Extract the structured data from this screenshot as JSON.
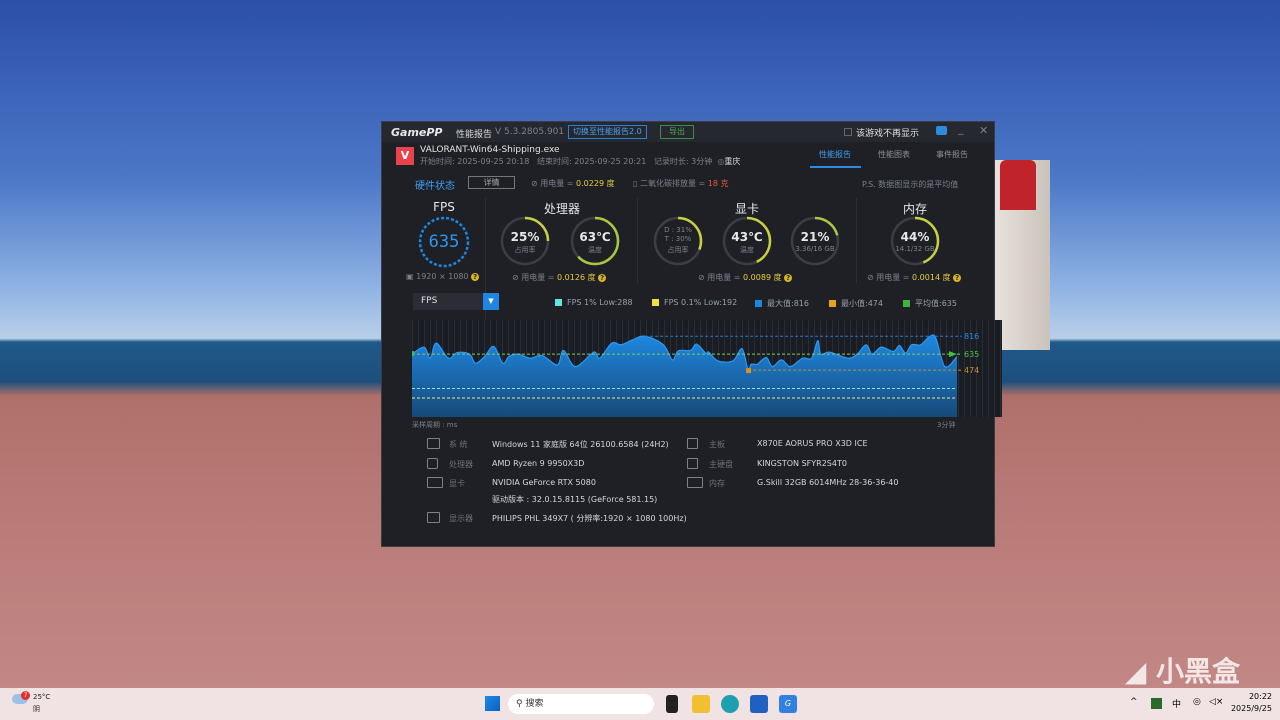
{
  "app": {
    "logo": "GamePP",
    "title": "性能报告",
    "version": "V 5.3.2805.901",
    "switch_btn": "切换至性能报告2.0",
    "export_btn": "导出",
    "no_show": "该游戏不再显示"
  },
  "session": {
    "exe": "VALORANT-Win64-Shipping.exe",
    "start": "开始时间: 2025-09-25 20:18",
    "end": "结束时间: 2025-09-25 20:21",
    "duration": "记录时长: 3分钟",
    "location": "重庆"
  },
  "tabs": [
    {
      "label": "性能报告",
      "active": true
    },
    {
      "label": "性能图表"
    },
    {
      "label": "事件报告"
    }
  ],
  "hardware": {
    "label": "硬件状态",
    "detail_btn": "详情",
    "power_label": "用电量 =",
    "power": "0.0229 度",
    "co2_label": "二氧化碳排放量 =",
    "co2": "18 克",
    "note": "P.S. 数据图显示的是平均值"
  },
  "fps_panel": {
    "title": "FPS",
    "value": "635",
    "resolution": "1920 × 1080"
  },
  "cpu_panel": {
    "title": "处理器",
    "usage": "25%",
    "usage_label": "占用率",
    "usage_frac": 0.25,
    "temp": "63℃",
    "temp_label": "温度",
    "temp_frac": 0.63,
    "power_label": "用电量 =",
    "power": "0.0126 度"
  },
  "gpu_panel": {
    "title": "显卡",
    "d": "D : 31%",
    "t": "T : 30%",
    "usage_label": "占用率",
    "usage_frac": 0.31,
    "temp": "43℃",
    "temp_label": "温度",
    "temp_frac": 0.43,
    "vram": "21%",
    "vram_detail": "3.36/16 GB",
    "vram_frac": 0.21,
    "power_label": "用电量 =",
    "power": "0.0089 度"
  },
  "mem_panel": {
    "title": "内存",
    "usage": "44%",
    "detail": "14.1/32 GB",
    "usage_frac": 0.44,
    "power_label": "用电量 =",
    "power": "0.0014 度"
  },
  "metric_select": "FPS",
  "legend": [
    {
      "label": "FPS 1% Low:288",
      "color": "#5ee8e0"
    },
    {
      "label": "FPS 0.1% Low:192",
      "color": "#f0e040"
    },
    {
      "label": "最大值:816",
      "color": "#1e86e0"
    },
    {
      "label": "最小值:474",
      "color": "#e8a020"
    },
    {
      "label": "平均值:635",
      "color": "#40b040"
    }
  ],
  "chart_data": {
    "type": "area",
    "title": "FPS",
    "xlabel": "采样周期 : ms",
    "x_end_label": "3分钟",
    "ylim": [
      0,
      980
    ],
    "x": [
      0,
      4,
      6,
      8,
      12,
      15,
      19,
      21,
      24,
      27,
      30,
      32,
      35,
      39,
      43,
      48,
      50,
      54,
      60,
      62,
      66,
      69,
      73,
      77,
      83,
      86,
      88,
      92,
      94,
      97,
      98,
      101,
      106,
      109,
      111,
      112,
      114,
      117,
      119,
      122,
      125,
      129,
      132,
      134,
      135,
      138,
      144,
      147,
      150,
      152,
      155,
      159,
      161,
      163,
      165,
      168,
      171,
      173,
      176,
      180
    ],
    "values": [
      635,
      706,
      594,
      747,
      594,
      652,
      635,
      543,
      611,
      713,
      543,
      611,
      635,
      594,
      621,
      526,
      672,
      509,
      655,
      594,
      747,
      730,
      781,
      816,
      730,
      577,
      669,
      672,
      737,
      645,
      655,
      567,
      567,
      689,
      474,
      533,
      533,
      601,
      509,
      577,
      509,
      594,
      594,
      771,
      635,
      655,
      594,
      635,
      730,
      635,
      706,
      662,
      723,
      645,
      730,
      730,
      815,
      798,
      509,
      611
    ],
    "max": 816,
    "min": 474,
    "avg": 635,
    "low1": 288,
    "low01": 192,
    "max_label": "816",
    "avg_label": "635",
    "min_label": "474"
  },
  "sysinfo": [
    {
      "label": "系 统",
      "value": "Windows 11 家庭版 64位 26100.6584 (24H2)"
    },
    {
      "label": "处理器",
      "value": "AMD Ryzen 9 9950X3D"
    },
    {
      "label": "显卡",
      "value": "NVIDIA GeForce RTX 5080",
      "extra": "驱动版本 : 32.0.15.8115 (GeForce 581.15)"
    },
    {
      "label": "显示器",
      "value": "PHILIPS PHL 349X7 ( 分辨率:1920 × 1080 100Hz)"
    },
    {
      "label": "主板",
      "value": "X870E AORUS PRO X3D ICE"
    },
    {
      "label": "主硬盘",
      "value": "KINGSTON SFYR2S4T0"
    },
    {
      "label": "内存",
      "value": "G.Skill 32GB 6014MHz 28-36-36-40"
    }
  ],
  "taskbar": {
    "weather_temp": "25°C",
    "weather_desc": "阴",
    "weather_badge": "7",
    "search": "搜索",
    "ime": "中",
    "time": "20:22",
    "date": "2025/9/25"
  },
  "watermark": "小黑盒"
}
